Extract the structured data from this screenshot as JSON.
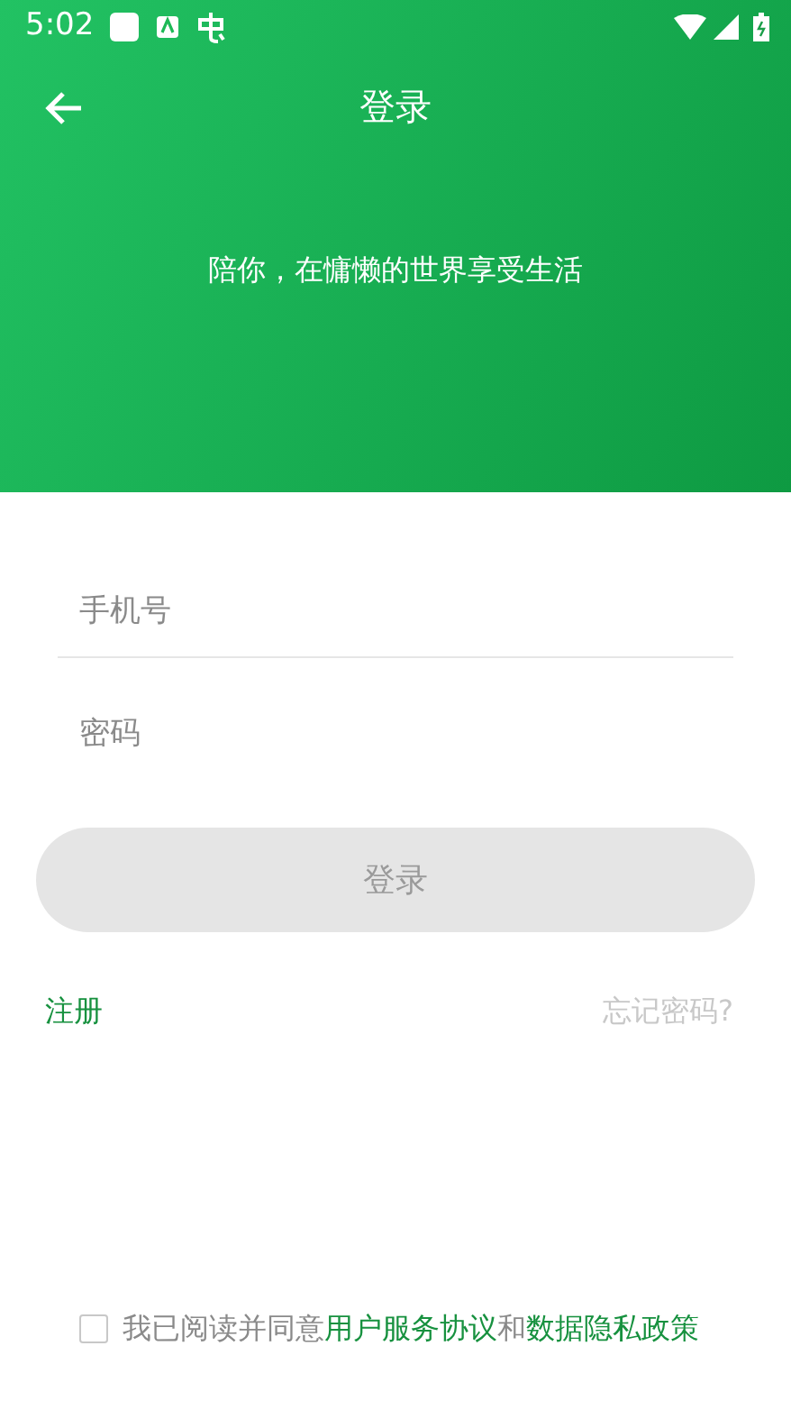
{
  "status_bar": {
    "time": "5:02"
  },
  "app_bar": {
    "title": "登录"
  },
  "slogan": "陪你，在慵懒的世界享受生活",
  "fields": [
    {
      "placeholder": "手机号"
    },
    {
      "placeholder": "密码"
    }
  ],
  "login_button": {
    "label": "登录",
    "disabled": true
  },
  "links": {
    "register": "注册",
    "forgot": "忘记密码?"
  },
  "agreement": {
    "checked": false,
    "parts": [
      {
        "text": "我已阅读并同意",
        "kind": "text"
      },
      {
        "text": "用户服务协议",
        "kind": "link"
      },
      {
        "text": "和",
        "kind": "text"
      },
      {
        "text": "数据隐私政策",
        "kind": "link"
      }
    ]
  }
}
